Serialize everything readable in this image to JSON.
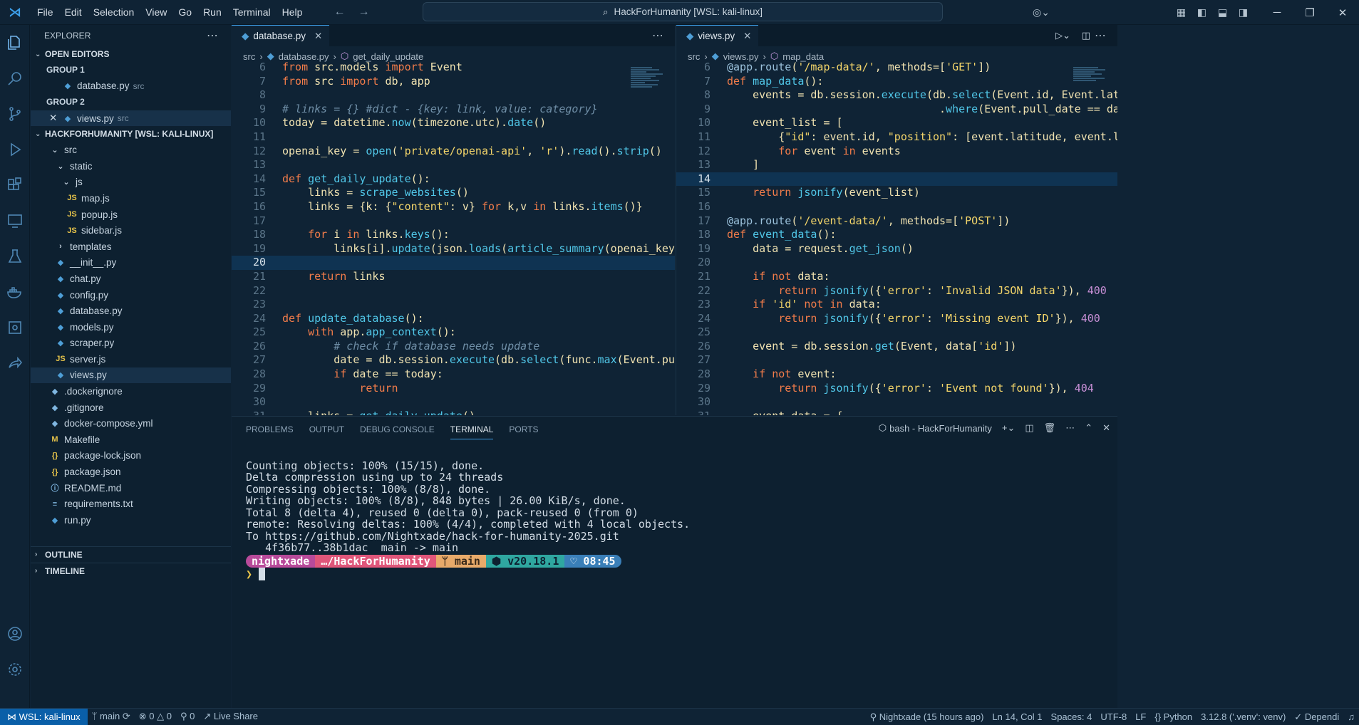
{
  "menu": [
    "File",
    "Edit",
    "Selection",
    "View",
    "Go",
    "Run",
    "Terminal",
    "Help"
  ],
  "search": {
    "label": "HackForHumanity [WSL: kali-linux]"
  },
  "sidebar": {
    "title": "EXPLORER",
    "open_editors": "OPEN EDITORS",
    "group1": "GROUP 1",
    "group2": "GROUP 2",
    "oe1": {
      "name": "database.py",
      "path": "src"
    },
    "oe2": {
      "name": "views.py",
      "path": "src"
    },
    "root": "HACKFORHUMANITY [WSL: KALI-LINUX]",
    "tree": [
      "src",
      "static",
      "js",
      "map.js",
      "popup.js",
      "sidebar.js",
      "templates",
      "__init__.py",
      "chat.py",
      "config.py",
      "database.py",
      "models.py",
      "scraper.py",
      "server.js",
      "views.py",
      ".dockerignore",
      ".gitignore",
      "docker-compose.yml",
      "Makefile",
      "package-lock.json",
      "package.json",
      "README.md",
      "requirements.txt",
      "run.py"
    ],
    "outline": "OUTLINE",
    "timeline": "TIMELINE"
  },
  "editorL": {
    "tab": "database.py",
    "crumb": [
      "src",
      "database.py",
      "get_daily_update"
    ]
  },
  "editorR": {
    "tab": "views.py",
    "crumb": [
      "src",
      "views.py",
      "map_data"
    ]
  },
  "panel": {
    "tabs": [
      "PROBLEMS",
      "OUTPUT",
      "DEBUG CONSOLE",
      "TERMINAL",
      "PORTS"
    ],
    "shell": "bash - HackForHumanity",
    "lines": [
      "Counting objects: 100% (15/15), done.",
      "Delta compression using up to 24 threads",
      "Compressing objects: 100% (8/8), done.",
      "Writing objects: 100% (8/8), 848 bytes | 26.00 KiB/s, done.",
      "Total 8 (delta 4), reused 0 (delta 0), pack-reused 0 (from 0)",
      "remote: Resolving deltas: 100% (4/4), completed with 4 local objects.",
      "To https://github.com/Nightxade/hack-for-humanity-2025.git",
      "   4f36b77..38b1dac  main -> main"
    ],
    "prompt": {
      "user": "nightxade",
      "dir": "…/HackForHumanity",
      "branch": "main",
      "node": "v20.18.1",
      "time": "08:45"
    }
  },
  "status": {
    "remote": "WSL: kali-linux",
    "branch": "main",
    "errors": "0",
    "warnings": "0",
    "ports": "0",
    "liveshare": "Live Share",
    "author": "Nightxade (15 hours ago)",
    "pos": "Ln 14, Col 1",
    "spaces": "Spaces: 4",
    "enc": "UTF-8",
    "eol": "LF",
    "lang": "Python",
    "interp": "3.12.8 ('.venv': venv)",
    "deps": "Dependi"
  }
}
